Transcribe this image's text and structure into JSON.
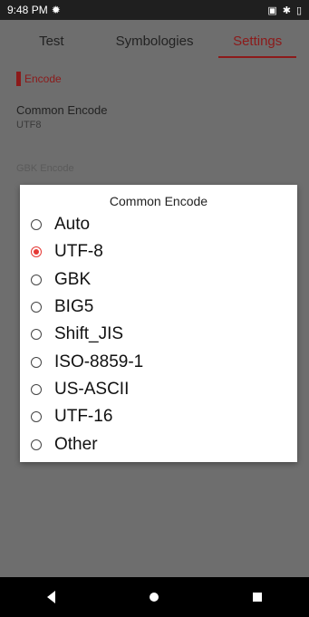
{
  "status_bar": {
    "time": "9:48 PM",
    "settings_icon": "gear-icon",
    "icons": [
      "screen-icon",
      "bluetooth-icon",
      "battery-icon"
    ]
  },
  "tabs": [
    {
      "label": "Test",
      "active": false
    },
    {
      "label": "Symbologies",
      "active": false
    },
    {
      "label": "Settings",
      "active": true
    }
  ],
  "section": {
    "title": "Encode"
  },
  "setting": {
    "title": "Common Encode",
    "value": "UTF8",
    "faded_label": "GBK Encode"
  },
  "dialog": {
    "title": "Common Encode",
    "options": [
      {
        "label": "Auto",
        "checked": false
      },
      {
        "label": "UTF-8",
        "checked": true
      },
      {
        "label": "GBK",
        "checked": false
      },
      {
        "label": "BIG5",
        "checked": false
      },
      {
        "label": "Shift_JIS",
        "checked": false
      },
      {
        "label": "ISO-8859-1",
        "checked": false
      },
      {
        "label": "US-ASCII",
        "checked": false
      },
      {
        "label": "UTF-16",
        "checked": false
      },
      {
        "label": "Other",
        "checked": false
      }
    ]
  },
  "colors": {
    "accent": "#8c1a1a",
    "radio_checked": "#e53935"
  }
}
